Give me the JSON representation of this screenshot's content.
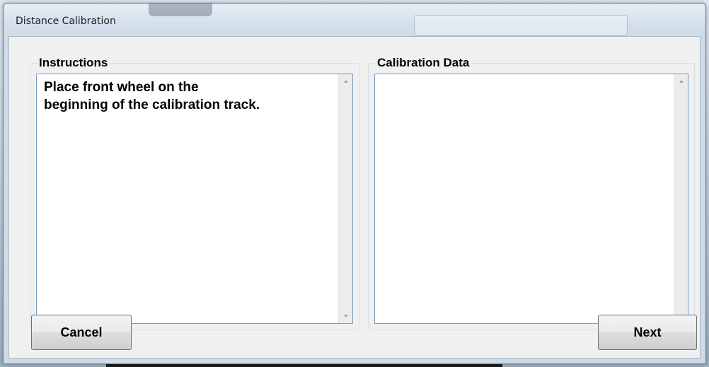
{
  "window": {
    "title": "Distance Calibration"
  },
  "instructions": {
    "label": "Instructions",
    "text": "Place front wheel on the\nbeginning of the calibration track."
  },
  "calibration_data": {
    "label": "Calibration Data",
    "text": ""
  },
  "buttons": {
    "cancel_label": "Cancel",
    "next_label": "Next"
  },
  "icons": {
    "scroll_up": "chevron-up-icon",
    "scroll_down": "chevron-down-icon"
  },
  "colors": {
    "client_background": "#f0f0f0",
    "textbox_border": "#7a9cc4",
    "button_border": "#707070"
  }
}
